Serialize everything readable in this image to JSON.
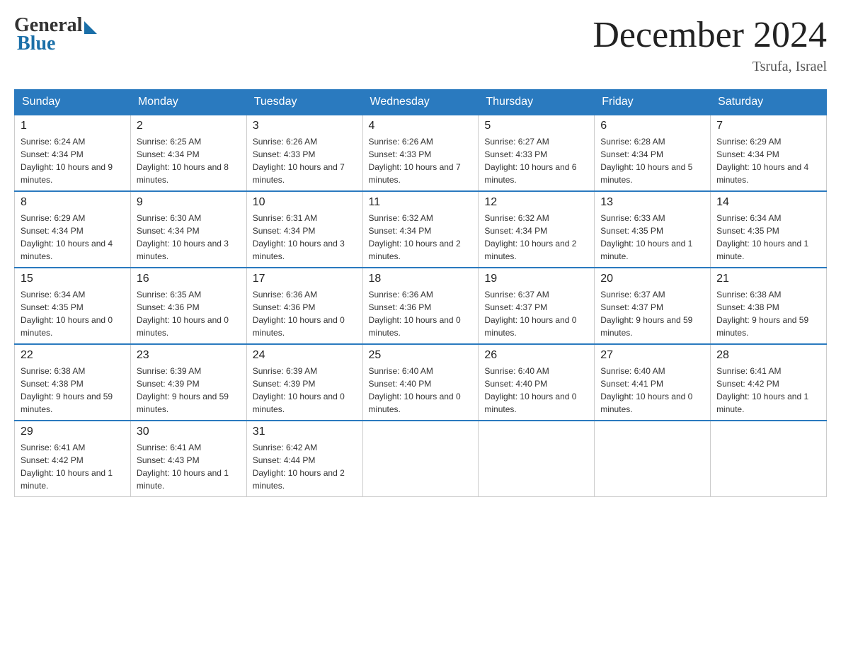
{
  "header": {
    "logo_general": "General",
    "logo_blue": "Blue",
    "month_title": "December 2024",
    "location": "Tsrufa, Israel"
  },
  "days_of_week": [
    "Sunday",
    "Monday",
    "Tuesday",
    "Wednesday",
    "Thursday",
    "Friday",
    "Saturday"
  ],
  "weeks": [
    [
      {
        "day": "1",
        "sunrise": "6:24 AM",
        "sunset": "4:34 PM",
        "daylight": "10 hours and 9 minutes."
      },
      {
        "day": "2",
        "sunrise": "6:25 AM",
        "sunset": "4:34 PM",
        "daylight": "10 hours and 8 minutes."
      },
      {
        "day": "3",
        "sunrise": "6:26 AM",
        "sunset": "4:33 PM",
        "daylight": "10 hours and 7 minutes."
      },
      {
        "day": "4",
        "sunrise": "6:26 AM",
        "sunset": "4:33 PM",
        "daylight": "10 hours and 7 minutes."
      },
      {
        "day": "5",
        "sunrise": "6:27 AM",
        "sunset": "4:33 PM",
        "daylight": "10 hours and 6 minutes."
      },
      {
        "day": "6",
        "sunrise": "6:28 AM",
        "sunset": "4:34 PM",
        "daylight": "10 hours and 5 minutes."
      },
      {
        "day": "7",
        "sunrise": "6:29 AM",
        "sunset": "4:34 PM",
        "daylight": "10 hours and 4 minutes."
      }
    ],
    [
      {
        "day": "8",
        "sunrise": "6:29 AM",
        "sunset": "4:34 PM",
        "daylight": "10 hours and 4 minutes."
      },
      {
        "day": "9",
        "sunrise": "6:30 AM",
        "sunset": "4:34 PM",
        "daylight": "10 hours and 3 minutes."
      },
      {
        "day": "10",
        "sunrise": "6:31 AM",
        "sunset": "4:34 PM",
        "daylight": "10 hours and 3 minutes."
      },
      {
        "day": "11",
        "sunrise": "6:32 AM",
        "sunset": "4:34 PM",
        "daylight": "10 hours and 2 minutes."
      },
      {
        "day": "12",
        "sunrise": "6:32 AM",
        "sunset": "4:34 PM",
        "daylight": "10 hours and 2 minutes."
      },
      {
        "day": "13",
        "sunrise": "6:33 AM",
        "sunset": "4:35 PM",
        "daylight": "10 hours and 1 minute."
      },
      {
        "day": "14",
        "sunrise": "6:34 AM",
        "sunset": "4:35 PM",
        "daylight": "10 hours and 1 minute."
      }
    ],
    [
      {
        "day": "15",
        "sunrise": "6:34 AM",
        "sunset": "4:35 PM",
        "daylight": "10 hours and 0 minutes."
      },
      {
        "day": "16",
        "sunrise": "6:35 AM",
        "sunset": "4:36 PM",
        "daylight": "10 hours and 0 minutes."
      },
      {
        "day": "17",
        "sunrise": "6:36 AM",
        "sunset": "4:36 PM",
        "daylight": "10 hours and 0 minutes."
      },
      {
        "day": "18",
        "sunrise": "6:36 AM",
        "sunset": "4:36 PM",
        "daylight": "10 hours and 0 minutes."
      },
      {
        "day": "19",
        "sunrise": "6:37 AM",
        "sunset": "4:37 PM",
        "daylight": "10 hours and 0 minutes."
      },
      {
        "day": "20",
        "sunrise": "6:37 AM",
        "sunset": "4:37 PM",
        "daylight": "9 hours and 59 minutes."
      },
      {
        "day": "21",
        "sunrise": "6:38 AM",
        "sunset": "4:38 PM",
        "daylight": "9 hours and 59 minutes."
      }
    ],
    [
      {
        "day": "22",
        "sunrise": "6:38 AM",
        "sunset": "4:38 PM",
        "daylight": "9 hours and 59 minutes."
      },
      {
        "day": "23",
        "sunrise": "6:39 AM",
        "sunset": "4:39 PM",
        "daylight": "9 hours and 59 minutes."
      },
      {
        "day": "24",
        "sunrise": "6:39 AM",
        "sunset": "4:39 PM",
        "daylight": "10 hours and 0 minutes."
      },
      {
        "day": "25",
        "sunrise": "6:40 AM",
        "sunset": "4:40 PM",
        "daylight": "10 hours and 0 minutes."
      },
      {
        "day": "26",
        "sunrise": "6:40 AM",
        "sunset": "4:40 PM",
        "daylight": "10 hours and 0 minutes."
      },
      {
        "day": "27",
        "sunrise": "6:40 AM",
        "sunset": "4:41 PM",
        "daylight": "10 hours and 0 minutes."
      },
      {
        "day": "28",
        "sunrise": "6:41 AM",
        "sunset": "4:42 PM",
        "daylight": "10 hours and 1 minute."
      }
    ],
    [
      {
        "day": "29",
        "sunrise": "6:41 AM",
        "sunset": "4:42 PM",
        "daylight": "10 hours and 1 minute."
      },
      {
        "day": "30",
        "sunrise": "6:41 AM",
        "sunset": "4:43 PM",
        "daylight": "10 hours and 1 minute."
      },
      {
        "day": "31",
        "sunrise": "6:42 AM",
        "sunset": "4:44 PM",
        "daylight": "10 hours and 2 minutes."
      },
      null,
      null,
      null,
      null
    ]
  ]
}
